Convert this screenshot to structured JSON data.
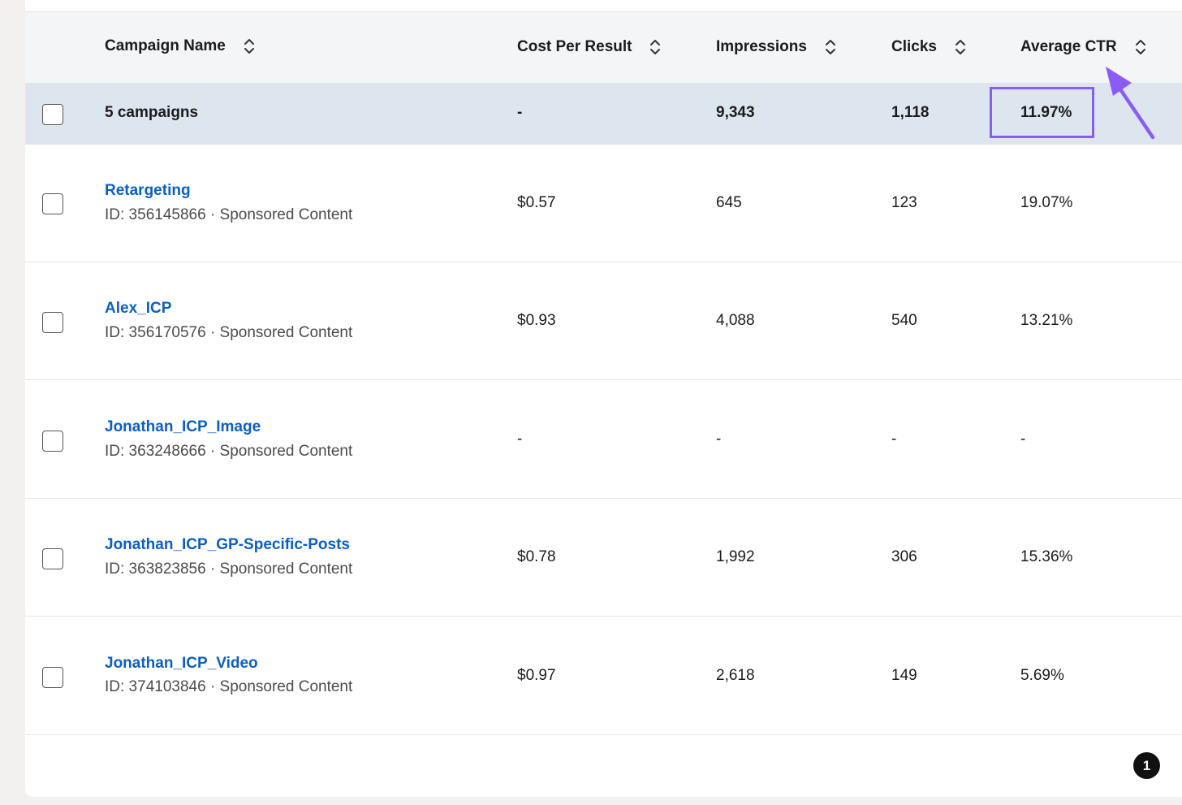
{
  "table": {
    "columns": [
      {
        "label": "Campaign Name"
      },
      {
        "label": "Cost Per Result"
      },
      {
        "label": "Impressions"
      },
      {
        "label": "Clicks"
      },
      {
        "label": "Average CTR"
      }
    ],
    "summary": {
      "label": "5 campaigns",
      "cost_per_result": "-",
      "impressions": "9,343",
      "clicks": "1,118",
      "average_ctr": "11.97%"
    },
    "rows": [
      {
        "name": "Retargeting",
        "meta": "ID: 356145866 · Sponsored Content",
        "cost_per_result": "$0.57",
        "impressions": "645",
        "clicks": "123",
        "average_ctr": "19.07%"
      },
      {
        "name": "Alex_ICP",
        "meta": "ID: 356170576 · Sponsored Content",
        "cost_per_result": "$0.93",
        "impressions": "4,088",
        "clicks": "540",
        "average_ctr": "13.21%"
      },
      {
        "name": "Jonathan_ICP_Image",
        "meta": "ID: 363248666 · Sponsored Content",
        "cost_per_result": "-",
        "impressions": "-",
        "clicks": "-",
        "average_ctr": "-"
      },
      {
        "name": "Jonathan_ICP_GP-Specific-Posts",
        "meta": "ID: 363823856 · Sponsored Content",
        "cost_per_result": "$0.78",
        "impressions": "1,992",
        "clicks": "306",
        "average_ctr": "15.36%"
      },
      {
        "name": "Jonathan_ICP_Video",
        "meta": "ID: 374103846 · Sponsored Content",
        "cost_per_result": "$0.97",
        "impressions": "2,618",
        "clicks": "149",
        "average_ctr": "5.69%"
      }
    ]
  },
  "pagination": {
    "current_page": "1"
  },
  "colors": {
    "link": "#0a5fc4",
    "summary_bg": "#dde6ef",
    "header_bg": "#f4f5f7",
    "annotation": "#8a5cf5"
  },
  "icons": {
    "sort": "sort-icon",
    "annotation_arrow": "arrow-icon"
  }
}
